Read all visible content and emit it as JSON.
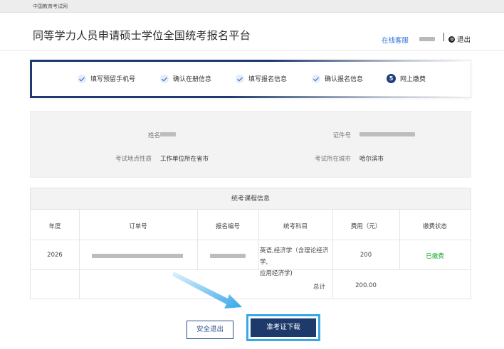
{
  "topbar": {
    "site_name": "中国教育考试网"
  },
  "header": {
    "title": "同等学力人员申请硕士学位全国统考报名平台",
    "online_service": "在线客服",
    "logout": "退出"
  },
  "steps": [
    {
      "label": "填写预留手机号",
      "status": "done"
    },
    {
      "label": "确认在册信息",
      "status": "done"
    },
    {
      "label": "填写报名信息",
      "status": "done"
    },
    {
      "label": "确认报名信息",
      "status": "done"
    },
    {
      "label": "网上缴费",
      "status": "current",
      "number": "5"
    }
  ],
  "info": {
    "name_label": "姓名",
    "id_label": "证件号",
    "location_type_label": "考试地点性质",
    "location_type_value": "工作单位所在省市",
    "city_label": "考试所在城市",
    "city_value": "哈尔滨市"
  },
  "course_table": {
    "caption": "统考课程信息",
    "headers": [
      "年度",
      "订单号",
      "报名编号",
      "统考科目",
      "费用（元）",
      "缴费状态"
    ],
    "row": {
      "year": "2026",
      "subject_line1": "英语,经济学（含理论经济学,",
      "subject_line2": "应用经济学)",
      "fee": "200",
      "status": "已缴费"
    },
    "total_label": "总计",
    "total_value": "200.00"
  },
  "buttons": {
    "exit": "安全退出",
    "download": "准考证下载"
  },
  "colors": {
    "primary": "#1d3a6b",
    "link": "#2f6fd8",
    "paid": "#18a832",
    "highlight": "#37a8e8"
  }
}
